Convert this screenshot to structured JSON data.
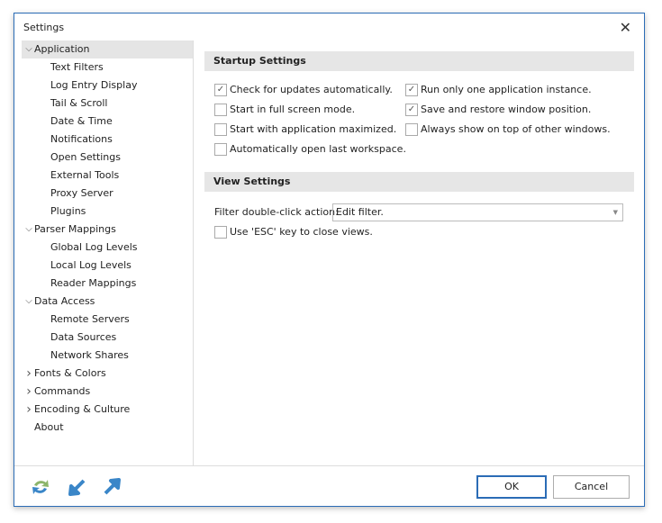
{
  "window": {
    "title": "Settings",
    "close_icon": "close-icon"
  },
  "tree": [
    {
      "label": "Application",
      "level": 0,
      "expanded": true,
      "selected": true
    },
    {
      "label": "Text Filters",
      "level": 1
    },
    {
      "label": "Log Entry Display",
      "level": 1
    },
    {
      "label": "Tail & Scroll",
      "level": 1
    },
    {
      "label": "Date & Time",
      "level": 1
    },
    {
      "label": "Notifications",
      "level": 1
    },
    {
      "label": "Open Settings",
      "level": 1
    },
    {
      "label": "External Tools",
      "level": 1
    },
    {
      "label": "Proxy Server",
      "level": 1
    },
    {
      "label": "Plugins",
      "level": 1
    },
    {
      "label": "Parser Mappings",
      "level": 0,
      "expanded": true
    },
    {
      "label": "Global Log Levels",
      "level": 1
    },
    {
      "label": "Local Log Levels",
      "level": 1
    },
    {
      "label": "Reader Mappings",
      "level": 1
    },
    {
      "label": "Data Access",
      "level": 0,
      "expanded": true
    },
    {
      "label": "Remote Servers",
      "level": 1
    },
    {
      "label": "Data Sources",
      "level": 1
    },
    {
      "label": "Network Shares",
      "level": 1
    },
    {
      "label": "Fonts & Colors",
      "level": 0,
      "expanded": false
    },
    {
      "label": "Commands",
      "level": 0,
      "expanded": false
    },
    {
      "label": "Encoding & Culture",
      "level": 0,
      "expanded": false
    },
    {
      "label": "About",
      "level": 0
    }
  ],
  "startup": {
    "title": "Startup Settings",
    "options": [
      {
        "label": "Check for updates automatically.",
        "checked": true
      },
      {
        "label": "Start in full screen mode.",
        "checked": false
      },
      {
        "label": "Start with application maximized.",
        "checked": false
      },
      {
        "label": "Automatically open last workspace.",
        "checked": false
      },
      {
        "label": "Run only one application instance.",
        "checked": true
      },
      {
        "label": "Save and restore window position.",
        "checked": true
      },
      {
        "label": "Always show on top of other windows.",
        "checked": false
      }
    ]
  },
  "view": {
    "title": "View Settings",
    "filter_label": "Filter double-click action:",
    "filter_value": "Edit filter.",
    "esc_label": "Use 'ESC' key to close views.",
    "esc_checked": false
  },
  "footer": {
    "ok": "OK",
    "cancel": "Cancel"
  }
}
